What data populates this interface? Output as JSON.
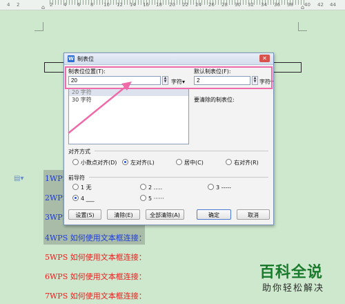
{
  "ruler": {
    "ticks": [
      "4",
      "2",
      "2",
      "4",
      "6",
      "8",
      "10",
      "12",
      "14",
      "16",
      "18",
      "20",
      "22",
      "24",
      "26",
      "28",
      "30",
      "32",
      "34",
      "36",
      "38",
      "40",
      "42",
      "44",
      "46"
    ]
  },
  "document": {
    "lines": [
      {
        "text": "1WPS",
        "color": "blue"
      },
      {
        "text": "2WPS",
        "color": "blue"
      },
      {
        "text": "3WPS",
        "color": "blue"
      },
      {
        "text": "4WPS 如何使用文本框连接：",
        "color": "blue"
      },
      {
        "text": "5WPS 如何使用文本框连接：",
        "color": "red"
      },
      {
        "text": "6WPS 如何使用文本框连接：",
        "color": "red"
      },
      {
        "text": "7WPS 如何使用文本框连接：",
        "color": "red"
      }
    ]
  },
  "dialog": {
    "title": "制表位",
    "tab_position_label": "制表位位置(T):",
    "tab_position_value": "20",
    "tab_position_unit": "字符▾",
    "default_tab_label": "默认制表位(F):",
    "default_tab_value": "2",
    "default_tab_unit": "字符▾",
    "list_items": [
      "20 字符",
      "30 字符"
    ],
    "to_clear_label": "要清除的制表位:",
    "alignment": {
      "label": "对齐方式",
      "options": [
        "小数点对齐(D)",
        "左对齐(L)",
        "居中(C)",
        "右对齐(R)"
      ],
      "selected": "左对齐(L)"
    },
    "leader": {
      "label": "前导符",
      "options": [
        "1 无",
        "2 .....",
        "3 -----",
        "4 ___",
        "5 ······"
      ],
      "selected": "4 ___"
    },
    "buttons": {
      "set": "设置(S)",
      "clear": "清除(E)",
      "clear_all": "全部清除(A)",
      "ok": "确定",
      "cancel": "取消"
    }
  },
  "watermark": {
    "brand": "百科全说",
    "slogan": "助你轻松解决"
  },
  "colors": {
    "highlight": "#ee6aa8",
    "doc_blue": "#1f3bd6",
    "doc_red": "#e82020",
    "background": "#cde8cd"
  }
}
